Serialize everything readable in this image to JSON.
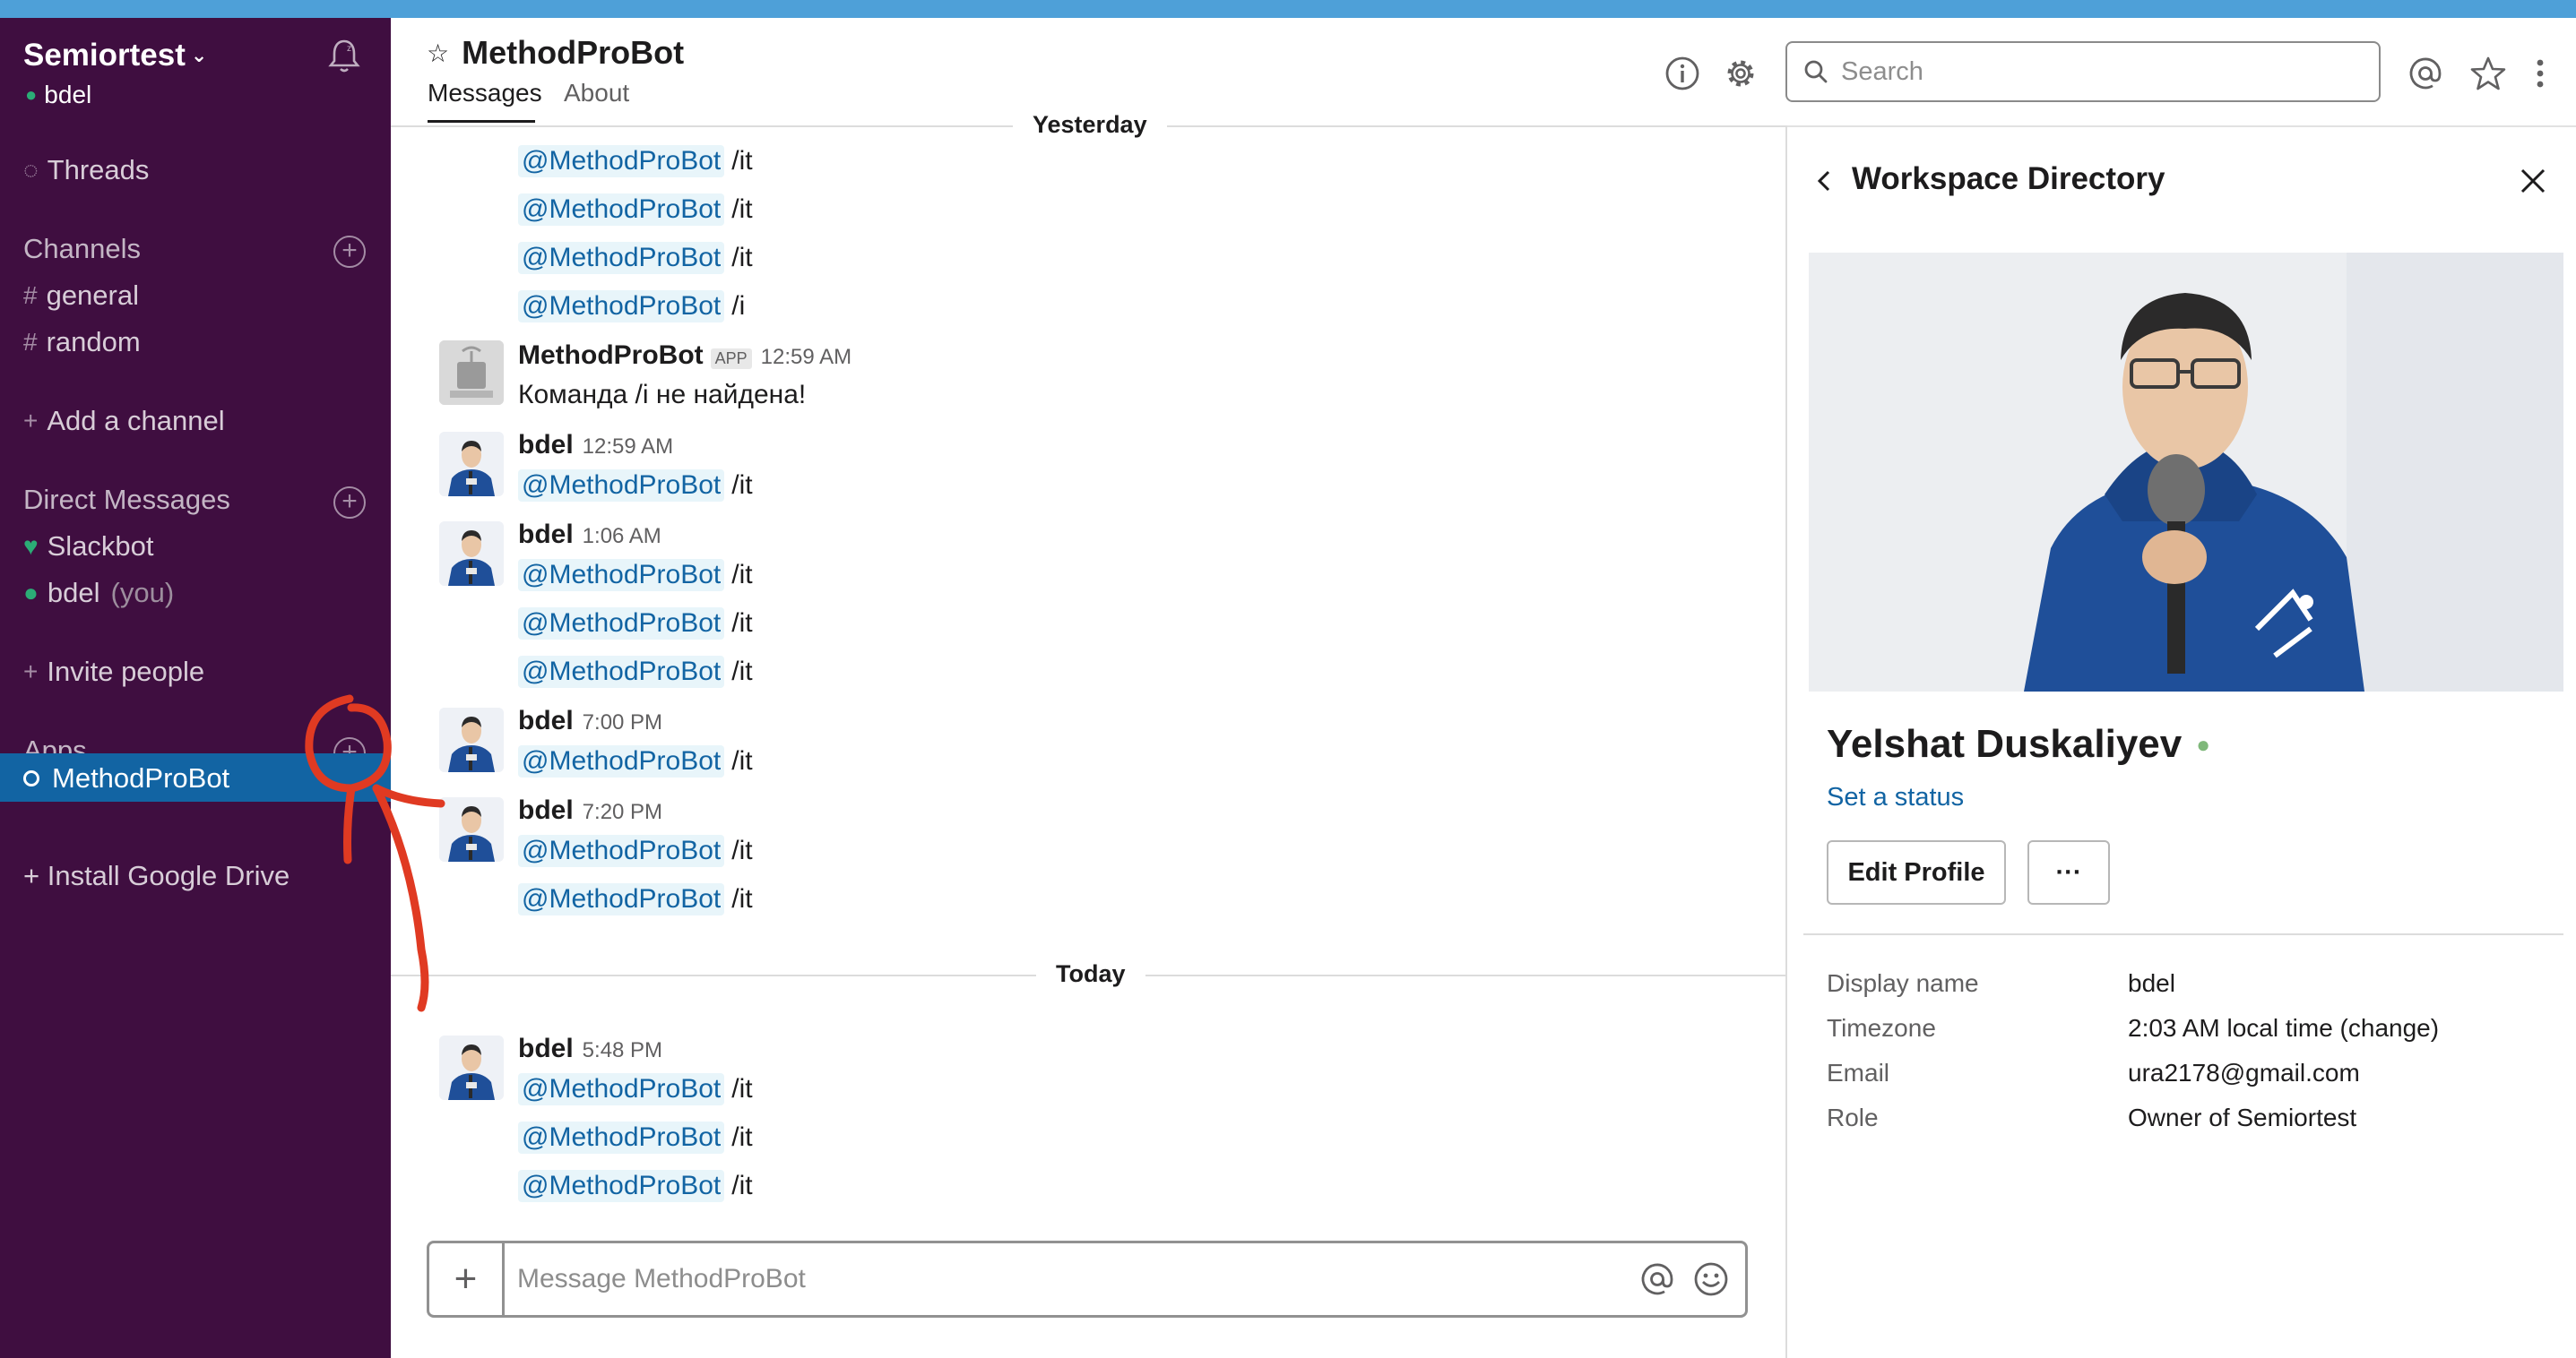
{
  "sidebar": {
    "workspace_name": "Semiortest",
    "current_user": "bdel",
    "threads_label": "Threads",
    "channels_header": "Channels",
    "channels": [
      {
        "name": "general"
      },
      {
        "name": "random"
      }
    ],
    "add_channel": "Add a channel",
    "dm_header": "Direct Messages",
    "dms": [
      {
        "name": "Slackbot",
        "suffix": ""
      },
      {
        "name": "bdel",
        "suffix": "(you)"
      }
    ],
    "invite_people": "Invite people",
    "apps_header": "Apps",
    "apps": [
      {
        "name": "MethodProBot"
      }
    ],
    "install_google_drive": "+ Install Google Drive"
  },
  "header": {
    "channel_title": "MethodProBot",
    "tabs": [
      {
        "label": "Messages"
      },
      {
        "label": "About"
      }
    ],
    "search_placeholder": "Search"
  },
  "messages": {
    "day_yesterday": "Yesterday",
    "day_today": "Today",
    "mention": "@MethodProBot",
    "bot_name": "MethodProBot",
    "app_badge": "APP",
    "user_name": "bdel",
    "lines": [
      {
        "text": "/it"
      },
      {
        "text": "/it"
      },
      {
        "text": "/it"
      },
      {
        "text": "/i"
      }
    ],
    "bot_msg": {
      "time": "12:59 AM",
      "text": "Команда /i не найдена!"
    },
    "groups": [
      {
        "time": "12:59 AM",
        "lines": [
          "/it"
        ]
      },
      {
        "time": "1:06 AM",
        "lines": [
          "/it",
          "/it",
          "/it"
        ]
      },
      {
        "time": "7:00 PM",
        "lines": [
          "/it"
        ]
      },
      {
        "time": "7:20 PM",
        "lines": [
          "/it",
          "/it"
        ]
      },
      {
        "time": "5:48 PM",
        "lines": [
          "/it",
          "/it",
          "/it"
        ]
      }
    ]
  },
  "composer": {
    "placeholder": "Message MethodProBot"
  },
  "panel": {
    "title": "Workspace Directory",
    "full_name": "Yelshat Duskaliyev",
    "set_status": "Set a status",
    "edit_profile": "Edit Profile",
    "more": "···",
    "fields": [
      {
        "label": "Display name",
        "value": "bdel"
      },
      {
        "label": "Timezone",
        "value": "2:03 AM local time (change)"
      },
      {
        "label": "Email",
        "value": "ura2178@gmail.com"
      },
      {
        "label": "Role",
        "value": "Owner of Semiortest"
      }
    ]
  },
  "colors": {
    "sidebar_bg": "#3f0e40",
    "active_item": "#1264a3",
    "mention_text": "#1264a3",
    "mention_bg": "#e8f5fa",
    "annotation": "#e03a22",
    "top_strip": "#4ea0d8"
  }
}
